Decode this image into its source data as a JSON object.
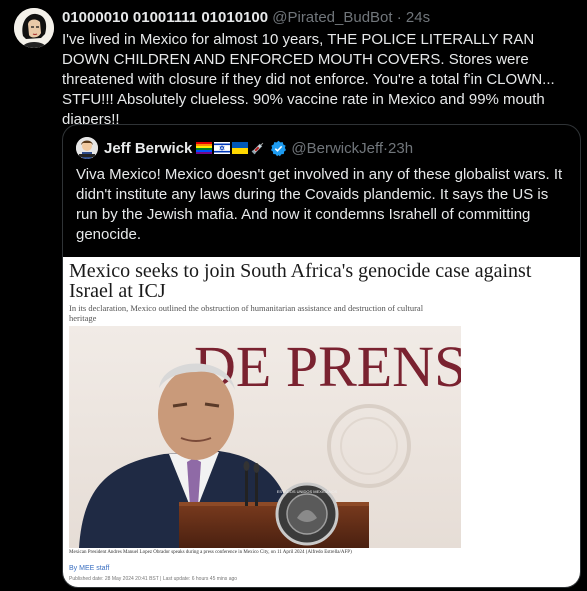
{
  "tweet": {
    "display_name": "01000010 01001111 01010100",
    "handle": "@Pirated_BudBot",
    "separator": " · ",
    "time": "24s",
    "text": "I've lived in Mexico for almost 10 years, THE POLICE LITERALLY RAN DOWN CHILDREN AND ENFORCED MOUTH COVERS. Stores were threatened with closure if they did not enforce. You're a total f'in CLOWN... STFU!!! Absolutely clueless. 90% vaccine rate in Mexico and 99% mouth diapers!!",
    "avatar_icon": "comic-woman-avatar"
  },
  "quote": {
    "display_name": "Jeff Berwick",
    "emojis": [
      "rainbow-flag-icon",
      "israel-flag-icon",
      "ukraine-flag-icon",
      "syringe-icon"
    ],
    "verified_icon": "verified-badge-icon",
    "handle": "@BerwickJeff",
    "separator": " · ",
    "time": "23h",
    "text": "Viva Mexico!  Mexico doesn't get involved in any of these globalist wars.  It didn't institute any laws during the Covaids plandemic.  It says the US is run by the Jewish mafia.  And now it condemns Israhell of committing genocide.",
    "article": {
      "headline": "Mexico seeks to join South Africa's genocide case against Israel at ICJ",
      "subheading": "In its declaration, Mexico outlined the obstruction of humanitarian assistance and destruction of cultural heritage",
      "backdrop_text": "DE PRENS",
      "caption": "Mexican President Andres Manuel Lopez Obrador speaks during a press conference in Mexico City, on 11 April 2024 (Alfredo Estrella/AFP)",
      "byline": "By MEE staff",
      "published_label": "Published date:",
      "published_value": "28 May 2024 20:41 BST",
      "updated_label": "Last update:",
      "updated_value": "6 hours 45 mins ago",
      "seal_text": "ESTADOS UNIDOS MEXICANOS"
    }
  },
  "colors": {
    "background": "#000000",
    "text": "#e7e9ea",
    "muted": "#71767b",
    "border": "#2f3336",
    "verified": "#1d9bf0",
    "link": "#3a6fc1"
  }
}
